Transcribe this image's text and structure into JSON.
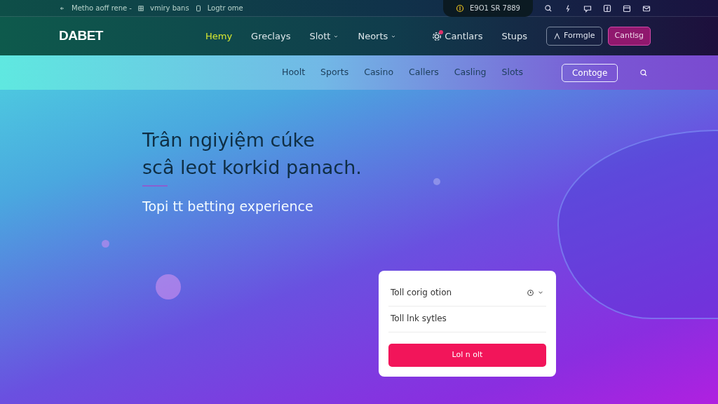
{
  "top_bar": {
    "items": [
      {
        "kind": "arrow",
        "text": "Metho aoff rene -"
      },
      {
        "kind": "grid",
        "text": "vmiry bans"
      },
      {
        "kind": "phone",
        "text": "Logtr ome"
      }
    ],
    "phone": "E9O1 SR 7889",
    "socials": [
      {
        "kind": "search"
      },
      {
        "kind": "bolt"
      },
      {
        "kind": "chat"
      },
      {
        "kind": "facebook"
      },
      {
        "kind": "calendar"
      },
      {
        "kind": "mail"
      }
    ]
  },
  "navbar": {
    "logo": "DABET",
    "links": [
      {
        "label": "Hemy",
        "selected": true,
        "dropdown": false,
        "badge": false
      },
      {
        "label": "Greclays",
        "selected": false,
        "dropdown": false,
        "badge": false
      },
      {
        "label": "Slott",
        "selected": false,
        "dropdown": true,
        "badge": false
      },
      {
        "label": "Neorts",
        "selected": false,
        "dropdown": true,
        "badge": false
      },
      {
        "label": "Cantlars",
        "selected": false,
        "dropdown": false,
        "badge": true
      },
      {
        "label": "Stups",
        "selected": false,
        "dropdown": false,
        "badge": false
      }
    ],
    "login_button": "Formgle",
    "register_button": "Cantlsg"
  },
  "subnav": {
    "links": [
      "Hoolt",
      "Sports",
      "Casino",
      "Callers",
      "Casling",
      "Slots"
    ],
    "button": "Contoge"
  },
  "hero": {
    "title_lines": [
      "Trân ngiyiệm cúke",
      "scâ leot korkid panach."
    ],
    "subtitle": "Topi tt betting experience"
  },
  "form": {
    "select": "Toll corig otion",
    "field": "Toll lnk sytles",
    "button": "Lol n olt"
  }
}
